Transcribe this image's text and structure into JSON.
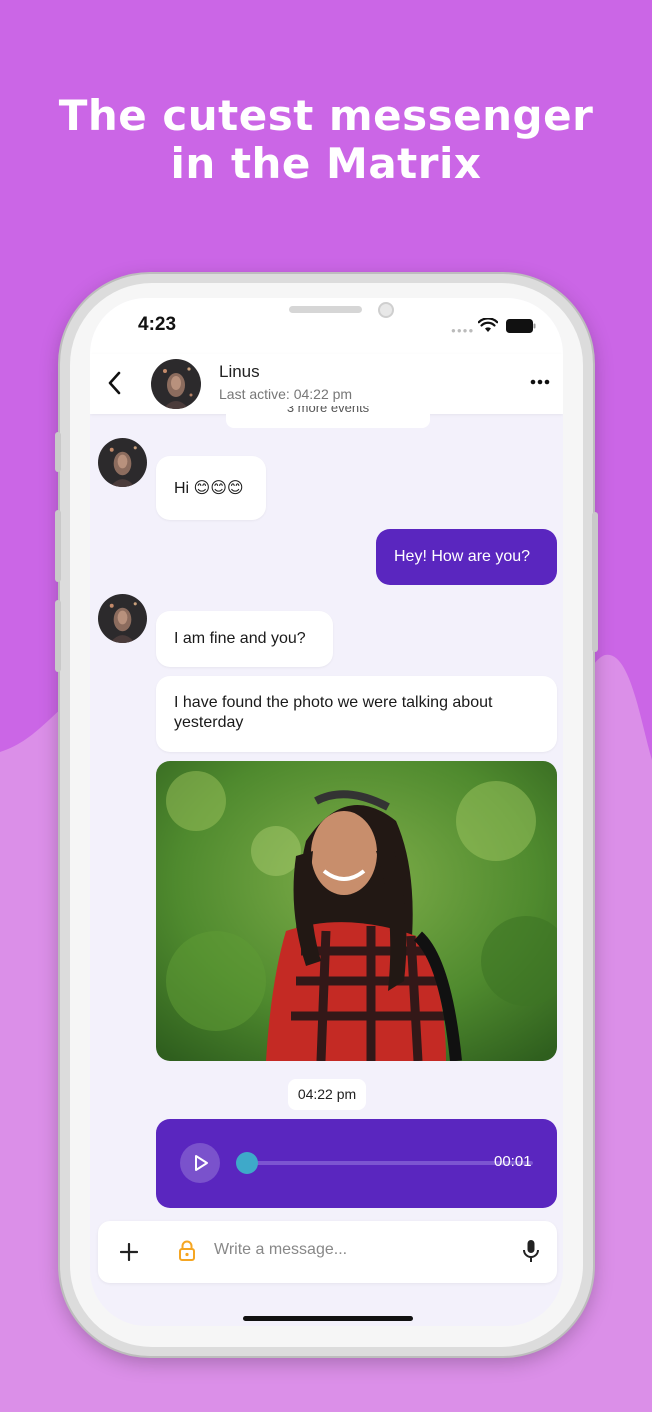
{
  "headline": {
    "line1": "The cutest messenger",
    "line2": "in the Matrix"
  },
  "colors": {
    "background_top": "#cb66e6",
    "background_bottom": "#db8fe8",
    "accent_bubble": "#5a26bf",
    "screen_bg": "#f3f1fb",
    "lock_icon": "#f5a623"
  },
  "status_bar": {
    "time": "4:23",
    "icons": [
      "signal-dots-icon",
      "wifi-icon",
      "battery-icon"
    ]
  },
  "header": {
    "back_icon": "chevron-left-icon",
    "name": "Linus",
    "subtitle": "Last active: 04:22 pm",
    "menu_icon": "more-horizontal-icon"
  },
  "events_chip": "3 more events",
  "messages": [
    {
      "direction": "in",
      "text": "Hi 😊😊😊"
    },
    {
      "direction": "out",
      "text": "Hey! How are you?"
    },
    {
      "direction": "in",
      "text": "I am fine and you?"
    },
    {
      "direction": "in",
      "text": "I have found the photo we were talking about yesterday"
    },
    {
      "direction": "in",
      "type": "image"
    }
  ],
  "timestamp_chip": "04:22 pm",
  "audio_message": {
    "duration": "00:01",
    "progress": 0.0,
    "play_icon": "play-icon"
  },
  "composer": {
    "add_icon": "plus-icon",
    "lock_icon": "lock-icon",
    "placeholder": "Write a message...",
    "mic_icon": "microphone-icon"
  }
}
